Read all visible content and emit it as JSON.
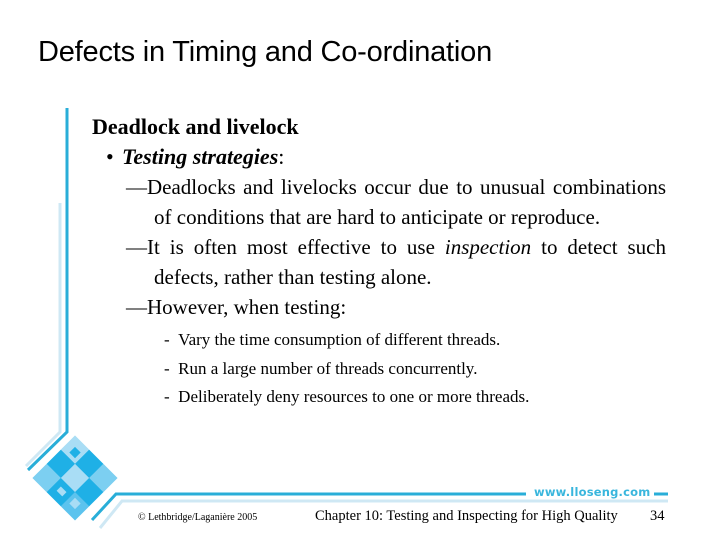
{
  "slide": {
    "title": "Defects in Timing and Co-ordination",
    "heading": "Deadlock and livelock",
    "bullet": {
      "mark": "•",
      "label_italic": "Testing strategies",
      "label_suffix": ":"
    },
    "items": [
      {
        "dash": "—",
        "text": "Deadlocks and livelocks occur due to unusual combinations of conditions that are hard to anticipate or reproduce."
      },
      {
        "dash": "—",
        "text_before": "It is often most effective to use ",
        "text_italic": "inspection",
        "text_after": " to detect such defects, rather than testing alone."
      },
      {
        "dash": "—",
        "text": "However, when testing:",
        "sub_items": [
          {
            "mark": "-",
            "text": "Vary the time consumption of different threads."
          },
          {
            "mark": "-",
            "text": "Run a large number of threads concurrently."
          },
          {
            "mark": "-",
            "text": "Deliberately deny resources to one or more threads."
          }
        ]
      }
    ]
  },
  "footer": {
    "url": "www.lloseng.com",
    "copyright": "© Lethbridge/Laganière 2005",
    "chapter_title": "Chapter 10: Testing and Inspecting for High Quality",
    "page_number": "34"
  },
  "colors": {
    "accent": "#29aed8",
    "accent_light": "#cfe8f4",
    "logo_dark": "#1fb0e6",
    "logo_mid": "#5cc3ee",
    "logo_light": "#a9ddf5"
  }
}
